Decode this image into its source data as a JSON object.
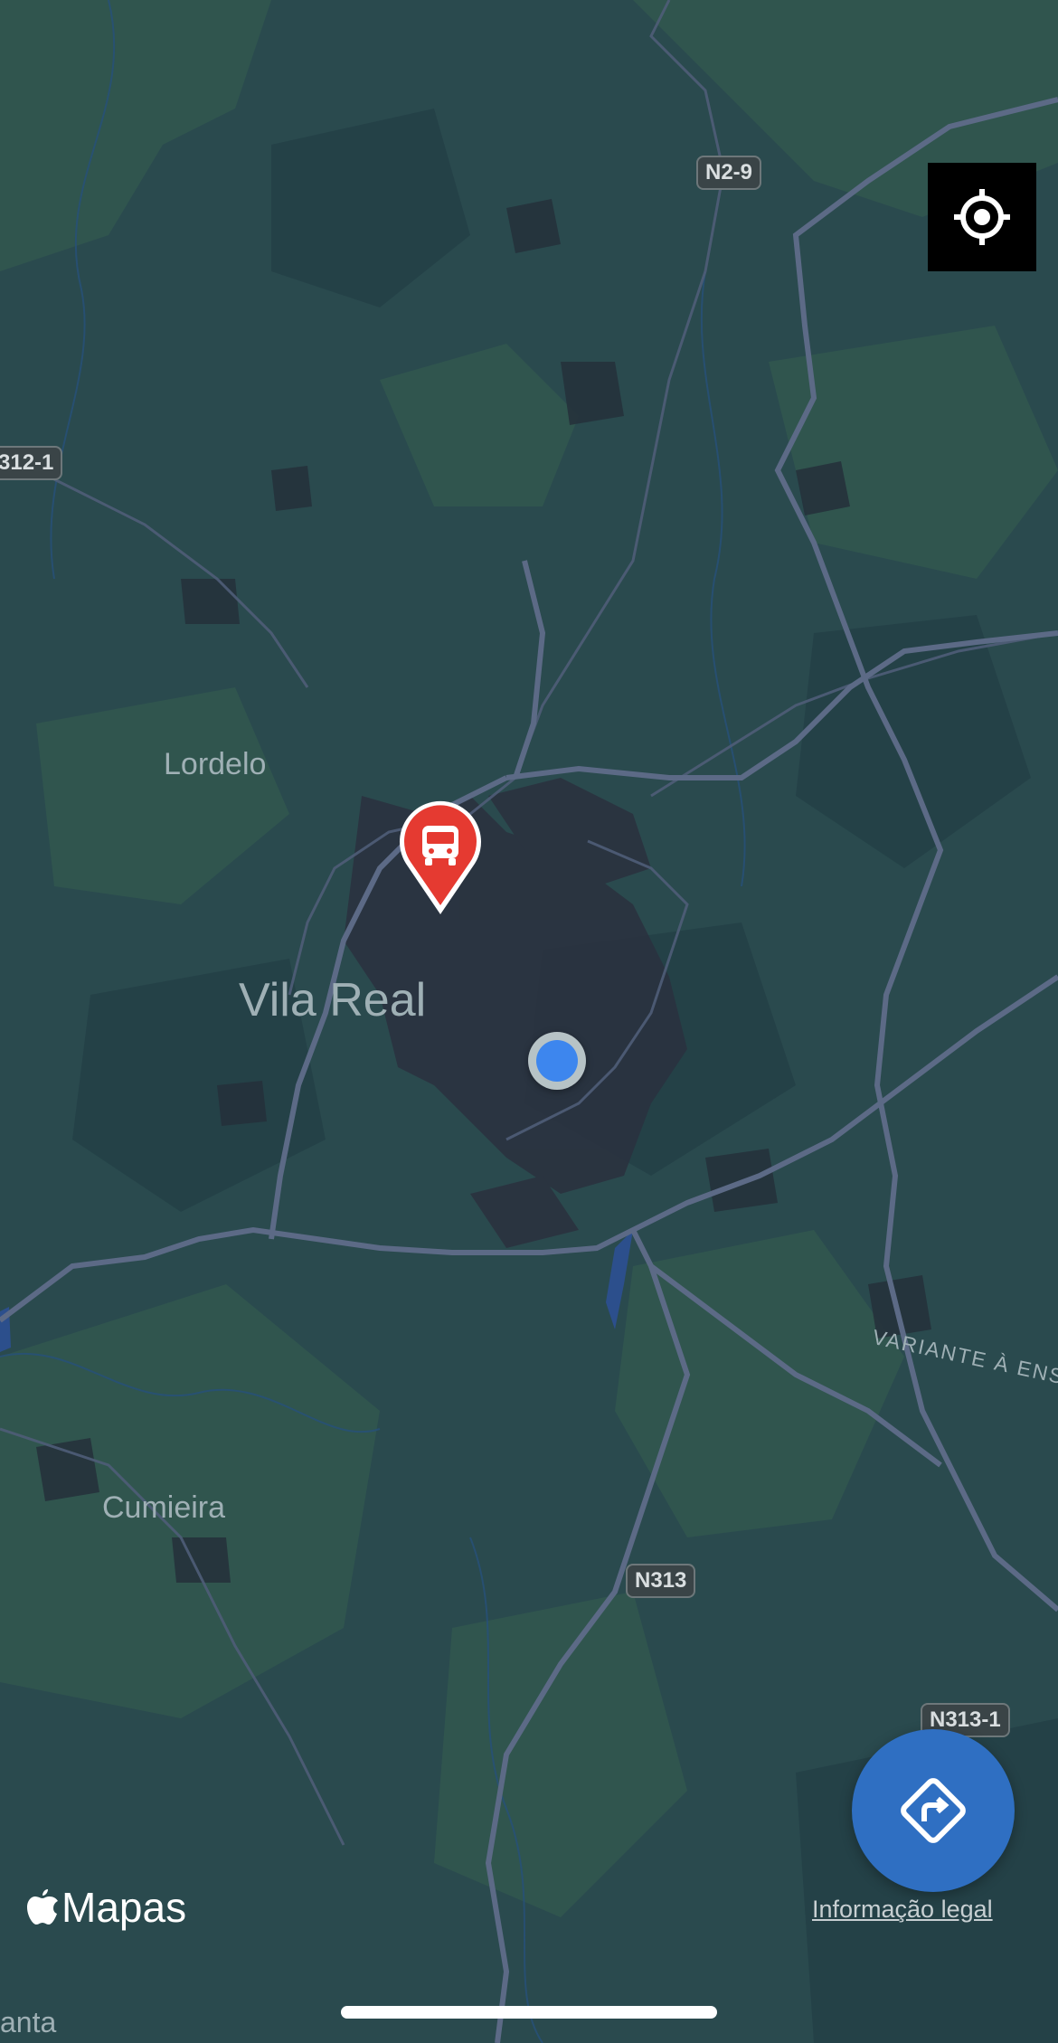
{
  "map": {
    "places": {
      "vila_real": "Vila Real",
      "lordelo": "Lordelo",
      "cumieira": "Cumieira",
      "santa": "anta"
    },
    "roads": {
      "n2_9": "N2-9",
      "n312_1": "312-1",
      "n313": "N313",
      "n313_1": "N313-1",
      "variante": "VARIANTE À ENS"
    },
    "markers": {
      "bus_stop_icon": "bus-icon",
      "bus_stop_color": "#e53a31",
      "user_location_color": "#3d86ee"
    }
  },
  "controls": {
    "locate_icon": "location-target-icon",
    "directions_icon": "directions-icon",
    "directions_color": "#2f6fc2"
  },
  "footer": {
    "brand": "Mapas",
    "legal": "Informação legal"
  }
}
